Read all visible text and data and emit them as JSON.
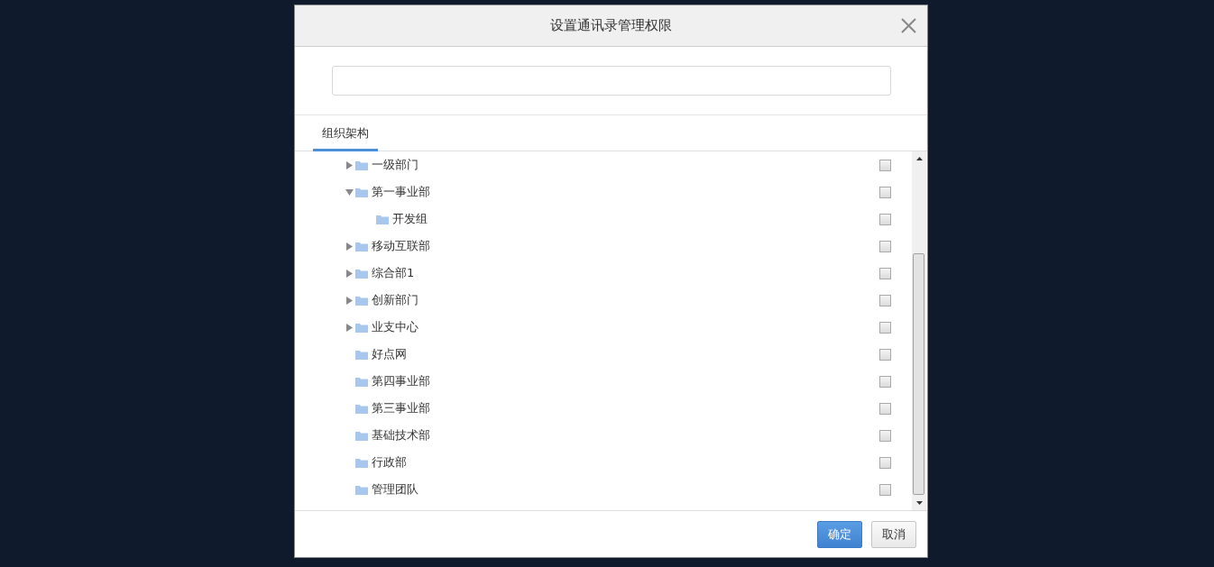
{
  "dialog": {
    "title": "设置通讯录管理权限",
    "tabs": [
      {
        "label": "组织架构",
        "selected": true
      }
    ],
    "tree": [
      {
        "label": "一级部门",
        "kind": "branch",
        "expanded": false,
        "checked": false
      },
      {
        "label": "第一事业部",
        "kind": "branch",
        "expanded": true,
        "checked": false,
        "children": [
          {
            "label": "开发组",
            "checked": false
          }
        ]
      },
      {
        "label": "移动互联部",
        "kind": "branch",
        "expanded": false,
        "checked": false
      },
      {
        "label": "综合部1",
        "kind": "branch",
        "expanded": false,
        "checked": false
      },
      {
        "label": "创新部门",
        "kind": "branch",
        "expanded": false,
        "checked": false
      },
      {
        "label": "业支中心",
        "kind": "branch",
        "expanded": false,
        "checked": false
      },
      {
        "label": "好点网",
        "kind": "leaf",
        "checked": false
      },
      {
        "label": "第四事业部",
        "kind": "leaf",
        "checked": false
      },
      {
        "label": "第三事业部",
        "kind": "leaf",
        "checked": false
      },
      {
        "label": "基础技术部",
        "kind": "leaf",
        "checked": false
      },
      {
        "label": "行政部",
        "kind": "leaf",
        "checked": false
      },
      {
        "label": "管理团队",
        "kind": "leaf",
        "checked": false
      }
    ],
    "buttons": [
      {
        "label": "确定",
        "kind": "primary"
      },
      {
        "label": "取消",
        "kind": "default"
      }
    ]
  }
}
